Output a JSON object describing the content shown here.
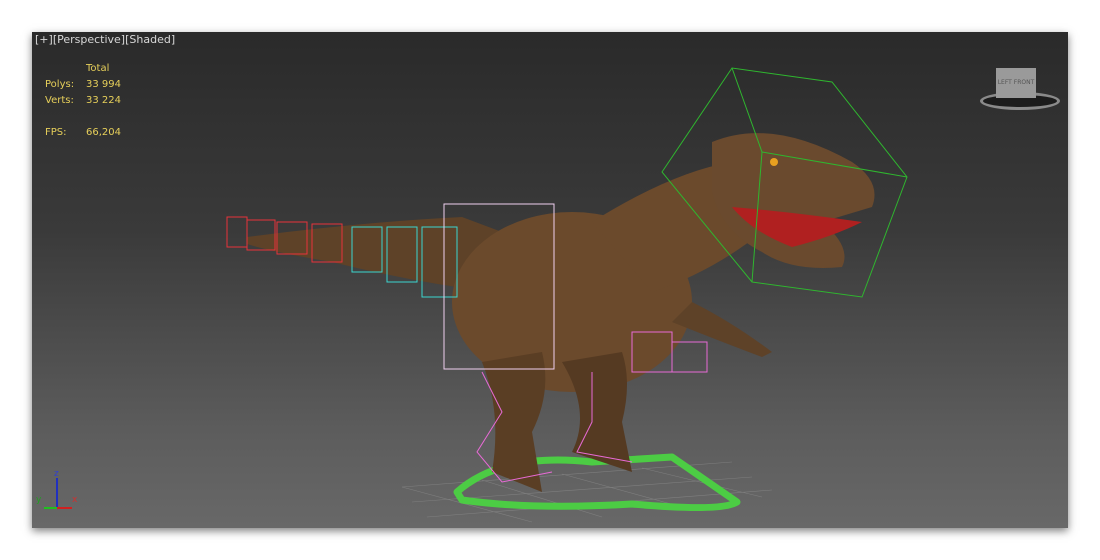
{
  "viewport": {
    "label_parts": [
      "[+]",
      "[Perspective]",
      "[Shaded]"
    ],
    "stats": {
      "header": "Total",
      "polys_label": "Polys:",
      "polys": "33 994",
      "verts_label": "Verts:",
      "verts": "33 224",
      "fps_label": "FPS:",
      "fps": "66,204"
    },
    "viewcube": {
      "face_left": "LEFT",
      "face_front": "FRONT"
    },
    "axes": {
      "z": "z",
      "y": "y",
      "x": "x"
    }
  },
  "colors": {
    "stats": "#e6cf5a",
    "body": "#6b4a2c",
    "bone_pink": "#e86ad6",
    "bone_red": "#e8323a",
    "bone_cyan": "#3bd6d0",
    "bone_green": "#2fb62f",
    "ctrl_green": "#4ccc44"
  }
}
